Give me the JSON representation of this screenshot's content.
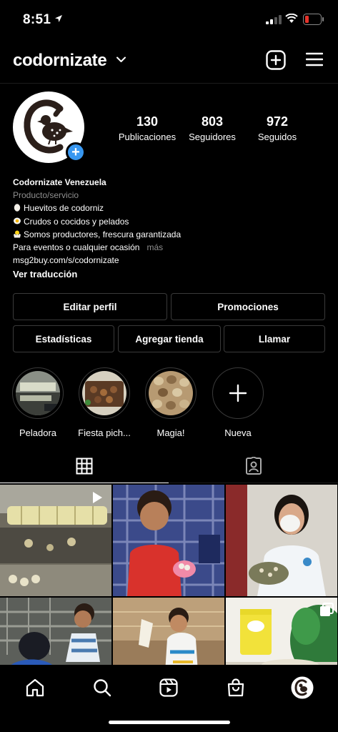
{
  "status_bar": {
    "time": "8:51"
  },
  "header": {
    "username": "codornizate"
  },
  "profile": {
    "stats": [
      {
        "value": "130",
        "label": "Publicaciones"
      },
      {
        "value": "803",
        "label": "Seguidores"
      },
      {
        "value": "972",
        "label": "Seguidos"
      }
    ],
    "name": "Codornizate Venezuela",
    "category": "Producto/servicio",
    "bio_lines": [
      "Huevitos de codorniz",
      "Crudos o cocidos y pelados",
      "Somos productores, frescura garantizada",
      "Para eventos o cualquier ocasión"
    ],
    "more": "más",
    "link": "msg2buy.com/s/codornizate",
    "translate": "Ver traducción"
  },
  "buttons": {
    "edit_profile": "Editar perfil",
    "promotions": "Promociones",
    "stats": "Estadísticas",
    "add_shop": "Agregar tienda",
    "call": "Llamar"
  },
  "highlights": [
    {
      "label": "Peladora"
    },
    {
      "label": "Fiesta pich..."
    },
    {
      "label": "Magia!"
    },
    {
      "label": "Nueva"
    }
  ],
  "tabs": {
    "active": "grid"
  },
  "colors": {
    "accent": "#3897f0",
    "background": "#000000",
    "border": "#3a3a3a",
    "muted": "#8e8e8e"
  },
  "icons": {
    "status": [
      "location-arrow-icon",
      "signal-icon",
      "wifi-icon",
      "battery-icon"
    ],
    "header": [
      "chevron-down-icon",
      "add-post-icon",
      "menu-icon"
    ],
    "nav": [
      "home-icon",
      "search-icon",
      "reels-icon",
      "shop-icon",
      "profile-avatar-icon"
    ]
  }
}
